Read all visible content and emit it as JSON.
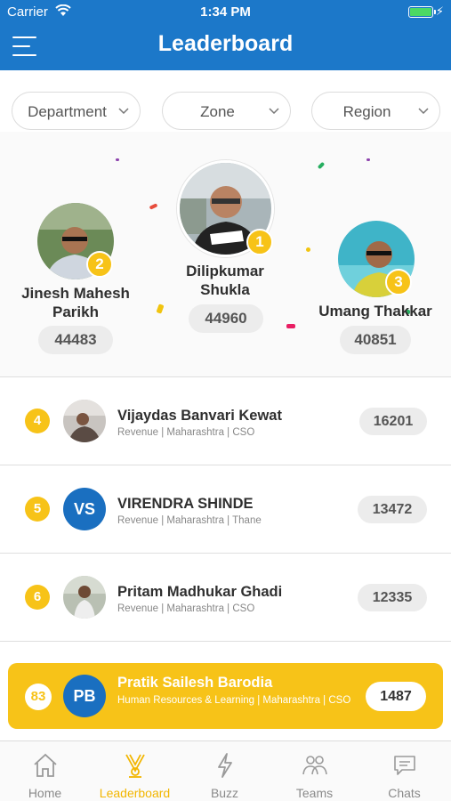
{
  "status_bar": {
    "carrier": "Carrier",
    "time": "1:34 PM"
  },
  "header": {
    "title": "Leaderboard"
  },
  "filters": [
    {
      "label": "Department"
    },
    {
      "label": "Zone"
    },
    {
      "label": "Region"
    }
  ],
  "podium": [
    {
      "rank": "1",
      "name_line1": "Dilipkumar",
      "name_line2": "Shukla",
      "score": "44960"
    },
    {
      "rank": "2",
      "name_line1": "Jinesh Mahesh",
      "name_line2": "Parikh",
      "score": "44483"
    },
    {
      "rank": "3",
      "name_line1": "Umang Thakkar",
      "name_line2": "",
      "score": "40851"
    }
  ],
  "list": [
    {
      "rank": "4",
      "initials": "",
      "name": "Vijaydas Banvari Kewat",
      "details": "Revenue | Maharashtra | CSO",
      "score": "16201"
    },
    {
      "rank": "5",
      "initials": "VS",
      "name": "VIRENDRA SHINDE",
      "details": "Revenue | Maharashtra | Thane",
      "score": "13472"
    },
    {
      "rank": "6",
      "initials": "",
      "name": "Pritam Madhukar Ghadi",
      "details": "Revenue | Maharashtra | CSO",
      "score": "12335"
    }
  ],
  "current_user": {
    "rank": "83",
    "initials": "PB",
    "name": "Pratik Sailesh Barodia",
    "details": "Human Resources & Learning | Maharashtra | CSO",
    "score": "1487"
  },
  "tabs": [
    {
      "label": "Home",
      "icon": "home-icon"
    },
    {
      "label": "Leaderboard",
      "icon": "trophy-icon",
      "active": true
    },
    {
      "label": "Buzz",
      "icon": "lightning-icon"
    },
    {
      "label": "Teams",
      "icon": "people-icon"
    },
    {
      "label": "Chats",
      "icon": "chat-icon"
    }
  ],
  "colors": {
    "primary": "#1c78c9",
    "accent": "#f7c318",
    "avatar_blue": "#1a6fc0"
  }
}
